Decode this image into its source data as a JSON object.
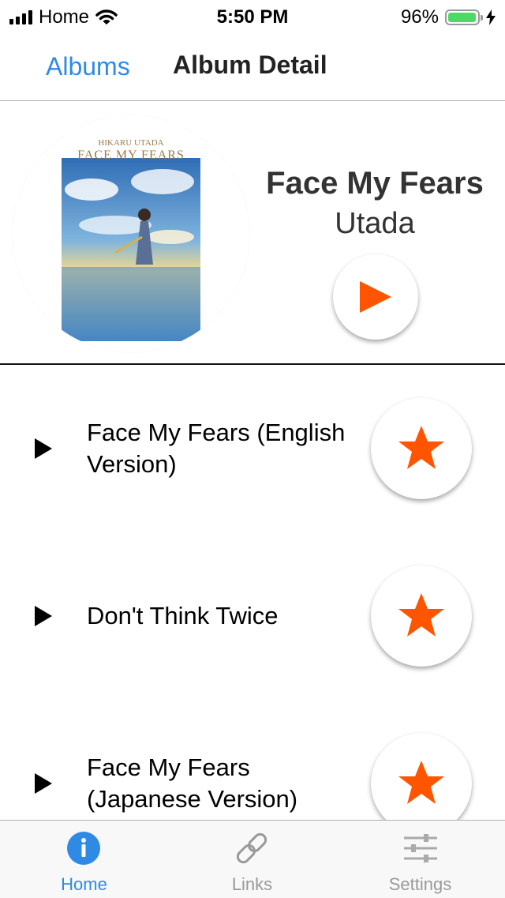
{
  "status_bar": {
    "carrier": "Home",
    "time": "5:50 PM",
    "battery_percent": "96%",
    "battery_level": 0.96,
    "battery_color": "#4cd964"
  },
  "nav": {
    "back_label": "Albums",
    "title": "Album Detail"
  },
  "album": {
    "title": "Face My Fears",
    "artist": "Utada",
    "cover_artist_text": "HIKARU UTADA",
    "cover_title_text": "FACE MY FEARS",
    "play_icon": "play-icon",
    "accent_color": "#ff5500"
  },
  "tracks": [
    {
      "title": "Face My Fears (English Version)",
      "favorite_icon": "star-icon"
    },
    {
      "title": "Don't Think Twice",
      "favorite_icon": "star-icon"
    },
    {
      "title": "Face My Fears (Japanese Version)",
      "favorite_icon": "star-icon"
    }
  ],
  "tab_bar": {
    "active_color": "#2f8ae6",
    "items": [
      {
        "label": "Home",
        "icon": "info-icon",
        "active": true
      },
      {
        "label": "Links",
        "icon": "link-icon",
        "active": false
      },
      {
        "label": "Settings",
        "icon": "sliders-icon",
        "active": false
      }
    ]
  }
}
